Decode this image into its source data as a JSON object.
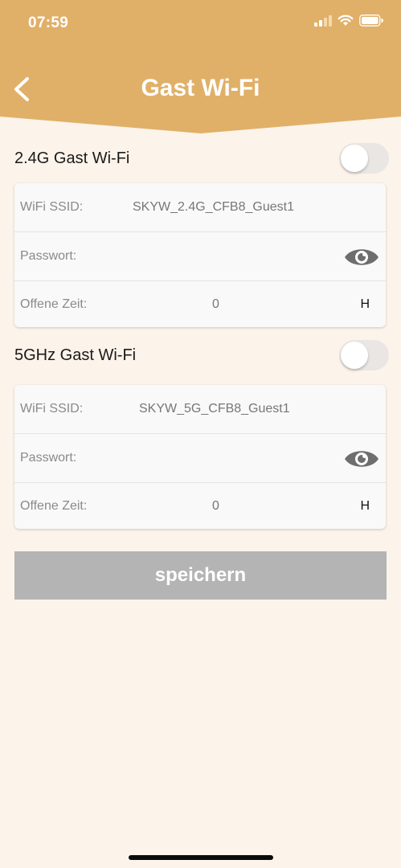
{
  "status_bar": {
    "time": "07:59"
  },
  "header": {
    "title": "Gast Wi-Fi",
    "back_icon": "chevron-left-icon",
    "color": "#e0b068"
  },
  "guest_24g": {
    "title": "2.4G Gast Wi-Fi",
    "enabled": false,
    "ssid_label": "WiFi SSID:",
    "ssid_value": "SKYW_2.4G_CFB8_Guest1",
    "password_label": "Passwort:",
    "password_value": "",
    "open_time_label": "Offene Zeit:",
    "open_time_value": "0",
    "open_time_unit": "H"
  },
  "guest_5g": {
    "title": "5GHz Gast Wi-Fi",
    "enabled": false,
    "ssid_label": "WiFi SSID:",
    "ssid_value": "SKYW_5G_CFB8_Guest1",
    "password_label": "Passwort:",
    "password_value": "",
    "open_time_label": "Offene Zeit:",
    "open_time_value": "0",
    "open_time_unit": "H"
  },
  "save_button": {
    "label": "speichern"
  },
  "colors": {
    "accent": "#e0b068",
    "background": "#fcf3ea",
    "button_disabled": "#b4b4b4"
  }
}
